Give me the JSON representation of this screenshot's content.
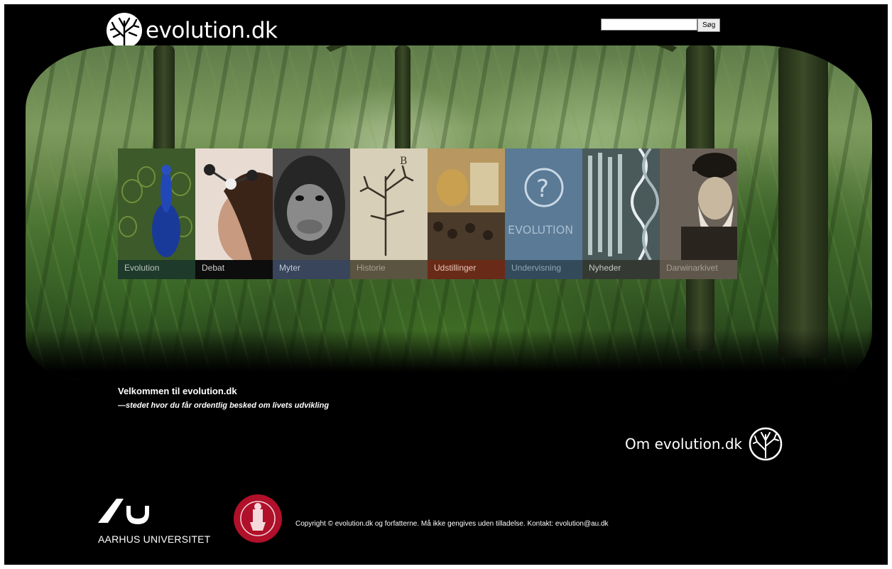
{
  "header": {
    "logo_text": "evolution.dk",
    "search": {
      "placeholder": "",
      "value": "",
      "button_label": "Søg"
    }
  },
  "nav": {
    "items": [
      {
        "label": "Evolution",
        "label_bg": "#1d3a2a",
        "label_color": "#b8c4b8"
      },
      {
        "label": "Debat",
        "label_bg": "#0d0d0d",
        "label_color": "#cfcfcf"
      },
      {
        "label": "Myter",
        "label_bg": "#39455a",
        "label_color": "#c0c8d8"
      },
      {
        "label": "Historie",
        "label_bg": "#5a5440",
        "label_color": "#a8a290"
      },
      {
        "label": "Udstillinger",
        "label_bg": "#6a2a18",
        "label_color": "#e6c8b8"
      },
      {
        "label": "Undervisning",
        "label_bg": "#334a5a",
        "label_color": "#8fa6b8"
      },
      {
        "label": "Nyheder",
        "label_bg": "#343a33",
        "label_color": "#c4c8c4"
      },
      {
        "label": "Darwinarkivet",
        "label_bg": "#5f574c",
        "label_color": "#a89e90"
      }
    ]
  },
  "welcome": {
    "title": "Velkommen til evolution.dk",
    "subtitle": "—stedet hvor du får ordentlig besked om livets udvikling"
  },
  "about": {
    "label": "Om evolution.dk"
  },
  "footer": {
    "au_label": "AARHUS UNIVERSITET",
    "copyright": "Copyright © evolution.dk og forfatterne. Må ikke gengives uden tilladelse. Kontakt: evolution@au.dk"
  },
  "colors": {
    "background": "#000000",
    "seal_red": "#b0102a"
  }
}
